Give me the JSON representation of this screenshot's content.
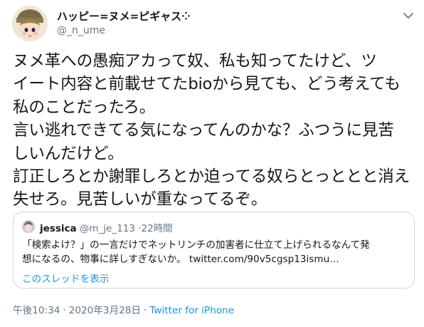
{
  "author": {
    "display_name": "ハッピー=ヌメ=ピギャス⁘",
    "handle": "@_n_ume"
  },
  "tweet": {
    "lines": [
      "ヌメ革への愚痴アカって奴、私も知ってたけど、ツ",
      "イート内容と前載せてたbioから見ても、どう考えても",
      "私のことだったろ。",
      "言い逃れできてる気になってんのかな？ふつうに見苦",
      "しいんだけど。",
      "訂正しろとか謝罪しろとか迫ってる奴らとっととと消え",
      "失せろ。見苦しいが重なってるぞ。"
    ]
  },
  "quoted_tweet": {
    "name": "jessica",
    "handle": "@m_je_113",
    "separator": "·",
    "time": "22時間",
    "text_line1": "「検索よけ？」の一言だけでネットリンチの加害者に仕立て上げられるなんて発",
    "text_line2": "想になるの、物事に詳しすぎないか。",
    "link": "twitter.com/90v5cgsp13ismu…",
    "show_thread": "このスレッドを表示"
  },
  "meta": {
    "time": "午後10:34",
    "dot": "·",
    "date": "2020年3月28日",
    "dot2": "·",
    "source": "Twitter for iPhone"
  },
  "colors": {
    "text": "#14171a",
    "muted": "#657786",
    "link": "#1b95e0",
    "border": "#ccd6dd"
  },
  "icons": {
    "caret": "chevron-down-icon"
  }
}
